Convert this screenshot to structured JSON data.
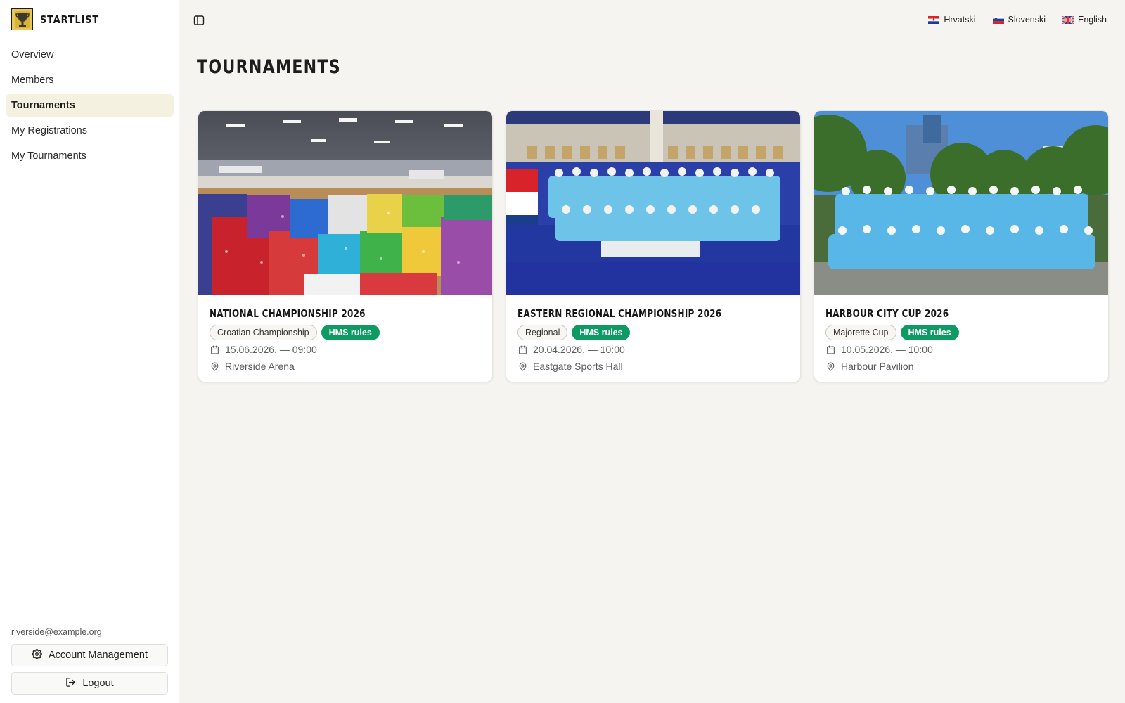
{
  "brand": {
    "name": "STARTLIST",
    "logo_icon": "trophy-icon"
  },
  "sidebar": {
    "items": [
      {
        "label": "Overview",
        "active": false
      },
      {
        "label": "Members",
        "active": false
      },
      {
        "label": "Tournaments",
        "active": true
      },
      {
        "label": "My Registrations",
        "active": false
      },
      {
        "label": "My Tournaments",
        "active": false
      }
    ],
    "user_email": "riverside@example.org",
    "account_label": "Account Management",
    "logout_label": "Logout"
  },
  "topbar": {
    "toggle_icon": "sidebar-toggle-icon",
    "languages": [
      {
        "label": "Hrvatski",
        "flag": "croatia-flag-icon"
      },
      {
        "label": "Slovenski",
        "flag": "slovenia-flag-icon"
      },
      {
        "label": "English",
        "flag": "uk-flag-icon"
      }
    ]
  },
  "page": {
    "title": "TOURNAMENTS"
  },
  "tournaments": [
    {
      "title": "NATIONAL CHAMPIONSHIP 2026",
      "category": "Croatian Championship",
      "rules": "HMS rules",
      "datetime": "15.06.2026. — 09:00",
      "venue": "Riverside Arena"
    },
    {
      "title": "EASTERN REGIONAL CHAMPIONSHIP 2026",
      "category": "Regional",
      "rules": "HMS rules",
      "datetime": "20.04.2026. — 10:00",
      "venue": "Eastgate Sports Hall"
    },
    {
      "title": "HARBOUR CITY CUP 2026",
      "category": "Majorette Cup",
      "rules": "HMS rules",
      "datetime": "10.05.2026. — 10:00",
      "venue": "Harbour Pavilion"
    }
  ],
  "colors": {
    "accent_green": "#0e9a63",
    "active_nav": "#f4f1e1",
    "background": "#f5f4f1"
  }
}
